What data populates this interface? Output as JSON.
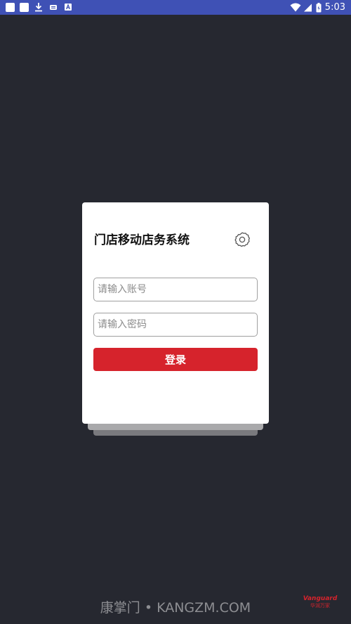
{
  "status_bar": {
    "time": "5:03",
    "notification_icons": [
      "notification-square-icon",
      "notification-square-icon",
      "download-icon",
      "keyboard-icon",
      "font-icon"
    ],
    "system_icons": [
      "wifi-icon",
      "cellular-signal-icon",
      "battery-icon"
    ],
    "color": "#3f51b5"
  },
  "login": {
    "title": "门店移动店务系统",
    "username_placeholder": "请输入账号",
    "password_placeholder": "请输入密码",
    "submit_label": "登录",
    "accent_color": "#d6232c"
  },
  "footer": {
    "watermark": "康掌门 • KANGZM.COM",
    "brand_en": "Vanguard",
    "brand_cn": "华润万家"
  }
}
